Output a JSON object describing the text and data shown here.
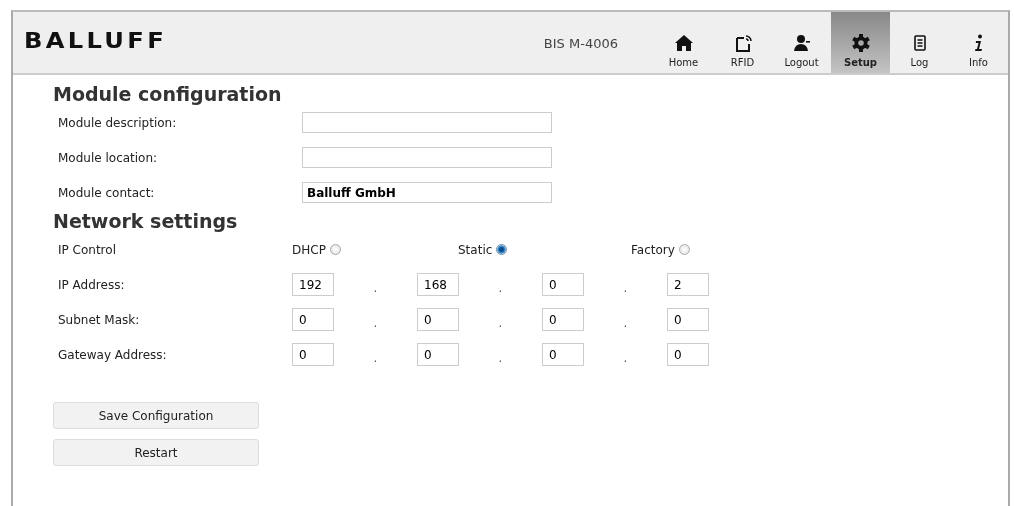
{
  "header": {
    "logo": "BALLUFF",
    "device": "BIS M-4006",
    "nav": [
      {
        "label": "Home",
        "selected": false
      },
      {
        "label": "RFID",
        "selected": false
      },
      {
        "label": "Logout",
        "selected": false
      },
      {
        "label": "Setup",
        "selected": true
      },
      {
        "label": "Log",
        "selected": false
      },
      {
        "label": "Info",
        "selected": false
      }
    ]
  },
  "module_configuration": {
    "title": "Module configuration",
    "fields": [
      {
        "label": "Module description:"
      },
      {
        "label": "Module location:"
      },
      {
        "label": "Module contact:",
        "value": "Balluff GmbH"
      }
    ]
  },
  "network_settings": {
    "title": "Network settings",
    "ip_control": {
      "label": "IP Control",
      "options": [
        {
          "label": "DHCP",
          "selected": false
        },
        {
          "label": "Static",
          "selected": true
        },
        {
          "label": "Factory",
          "selected": false
        }
      ]
    },
    "addresses": [
      {
        "label": "IP Address:",
        "octets": [
          "192",
          "168",
          "0",
          "2"
        ],
        "separator": "."
      },
      {
        "label": "Subnet Mask:",
        "octets": [
          "0",
          "0",
          "0",
          "0"
        ],
        "separator": "."
      },
      {
        "label": "Gateway Address:",
        "octets": [
          "0",
          "0",
          "0",
          "0"
        ],
        "separator": "."
      }
    ]
  },
  "buttons": [
    "Save Configuration",
    "Restart"
  ]
}
